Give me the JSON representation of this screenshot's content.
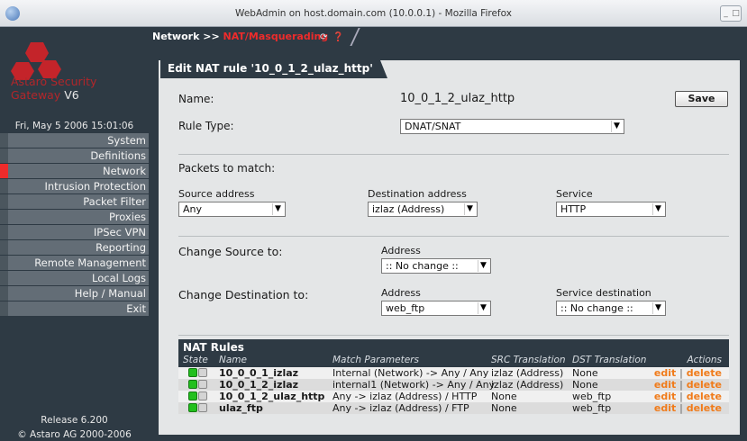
{
  "window": {
    "title": "WebAdmin on host.domain.com (10.0.0.1) - Mozilla Firefox"
  },
  "sidebar": {
    "brand_line1": "Astaro Security",
    "brand_line2": "Gateway",
    "brand_version": "V6",
    "datetime": "Fri, May 5 2006 15:01:06",
    "items": [
      {
        "label": "System",
        "active": false
      },
      {
        "label": "Definitions",
        "active": false
      },
      {
        "label": "Network",
        "active": true
      },
      {
        "label": "Intrusion Protection",
        "active": false
      },
      {
        "label": "Packet Filter",
        "active": false
      },
      {
        "label": "Proxies",
        "active": false
      },
      {
        "label": "IPSec VPN",
        "active": false
      },
      {
        "label": "Reporting",
        "active": false
      },
      {
        "label": "Remote Management",
        "active": false
      },
      {
        "label": "Local Logs",
        "active": false
      },
      {
        "label": "Help / Manual",
        "active": false
      },
      {
        "label": "Exit",
        "active": false
      }
    ],
    "release": "Release 6.200",
    "copyright": "© Astaro AG 2000-2006"
  },
  "breadcrumb": {
    "parent": "Network",
    "separator": ">>",
    "current": "NAT/Masquerading"
  },
  "panel": {
    "title": "Edit NAT rule '10_0_1_2_ulaz_http'",
    "name_label": "Name:",
    "name_value": "10_0_1_2_ulaz_http",
    "save_label": "Save",
    "rule_type_label": "Rule Type:",
    "rule_type_value": "DNAT/SNAT",
    "packets_label": "Packets to match:",
    "source_label": "Source address",
    "source_value": "Any",
    "dest_label": "Destination address",
    "dest_value": "izlaz (Address)",
    "service_label": "Service",
    "service_value": "HTTP",
    "change_src_label": "Change Source to:",
    "change_src_addr_label": "Address",
    "change_src_addr_value": ":: No change ::",
    "change_dst_label": "Change Destination to:",
    "change_dst_addr_label": "Address",
    "change_dst_addr_value": "web_ftp",
    "service_dest_label": "Service destination",
    "service_dest_value": ":: No change ::"
  },
  "nat_rules": {
    "title": "NAT Rules",
    "headers": [
      "State",
      "Name",
      "Match Parameters",
      "SRC Translation",
      "DST Translation",
      "Actions"
    ],
    "rows": [
      {
        "name": "10_0_0_1_izlaz",
        "match": "Internal (Network) -> Any / Any",
        "src": "izlaz (Address)",
        "dst": "None",
        "edit": "edit",
        "sep": "|",
        "delete": "delete"
      },
      {
        "name": "10_0_1_2_izlaz",
        "match": "internal1 (Network) -> Any / Any",
        "src": "izlaz (Address)",
        "dst": "None",
        "edit": "edit",
        "sep": "|",
        "delete": "delete"
      },
      {
        "name": "10_0_1_2_ulaz_http",
        "match": "Any -> izlaz (Address) / HTTP",
        "src": "None",
        "dst": "web_ftp",
        "edit": "edit",
        "sep": "|",
        "delete": "delete"
      },
      {
        "name": "ulaz_ftp",
        "match": "Any -> izlaz (Address) / FTP",
        "src": "None",
        "dst": "web_ftp",
        "edit": "edit",
        "sep": "|",
        "delete": "delete"
      }
    ]
  },
  "colors": {
    "accent_red": "#ee2b2b",
    "sidebar_bg": "#2e3a44",
    "action_orange": "#f07b1a",
    "state_on": "#22c01d"
  },
  "icons": {
    "refresh": "refresh-icon",
    "help": "help-icon",
    "select_arrow": "dropdown-arrow-icon"
  }
}
